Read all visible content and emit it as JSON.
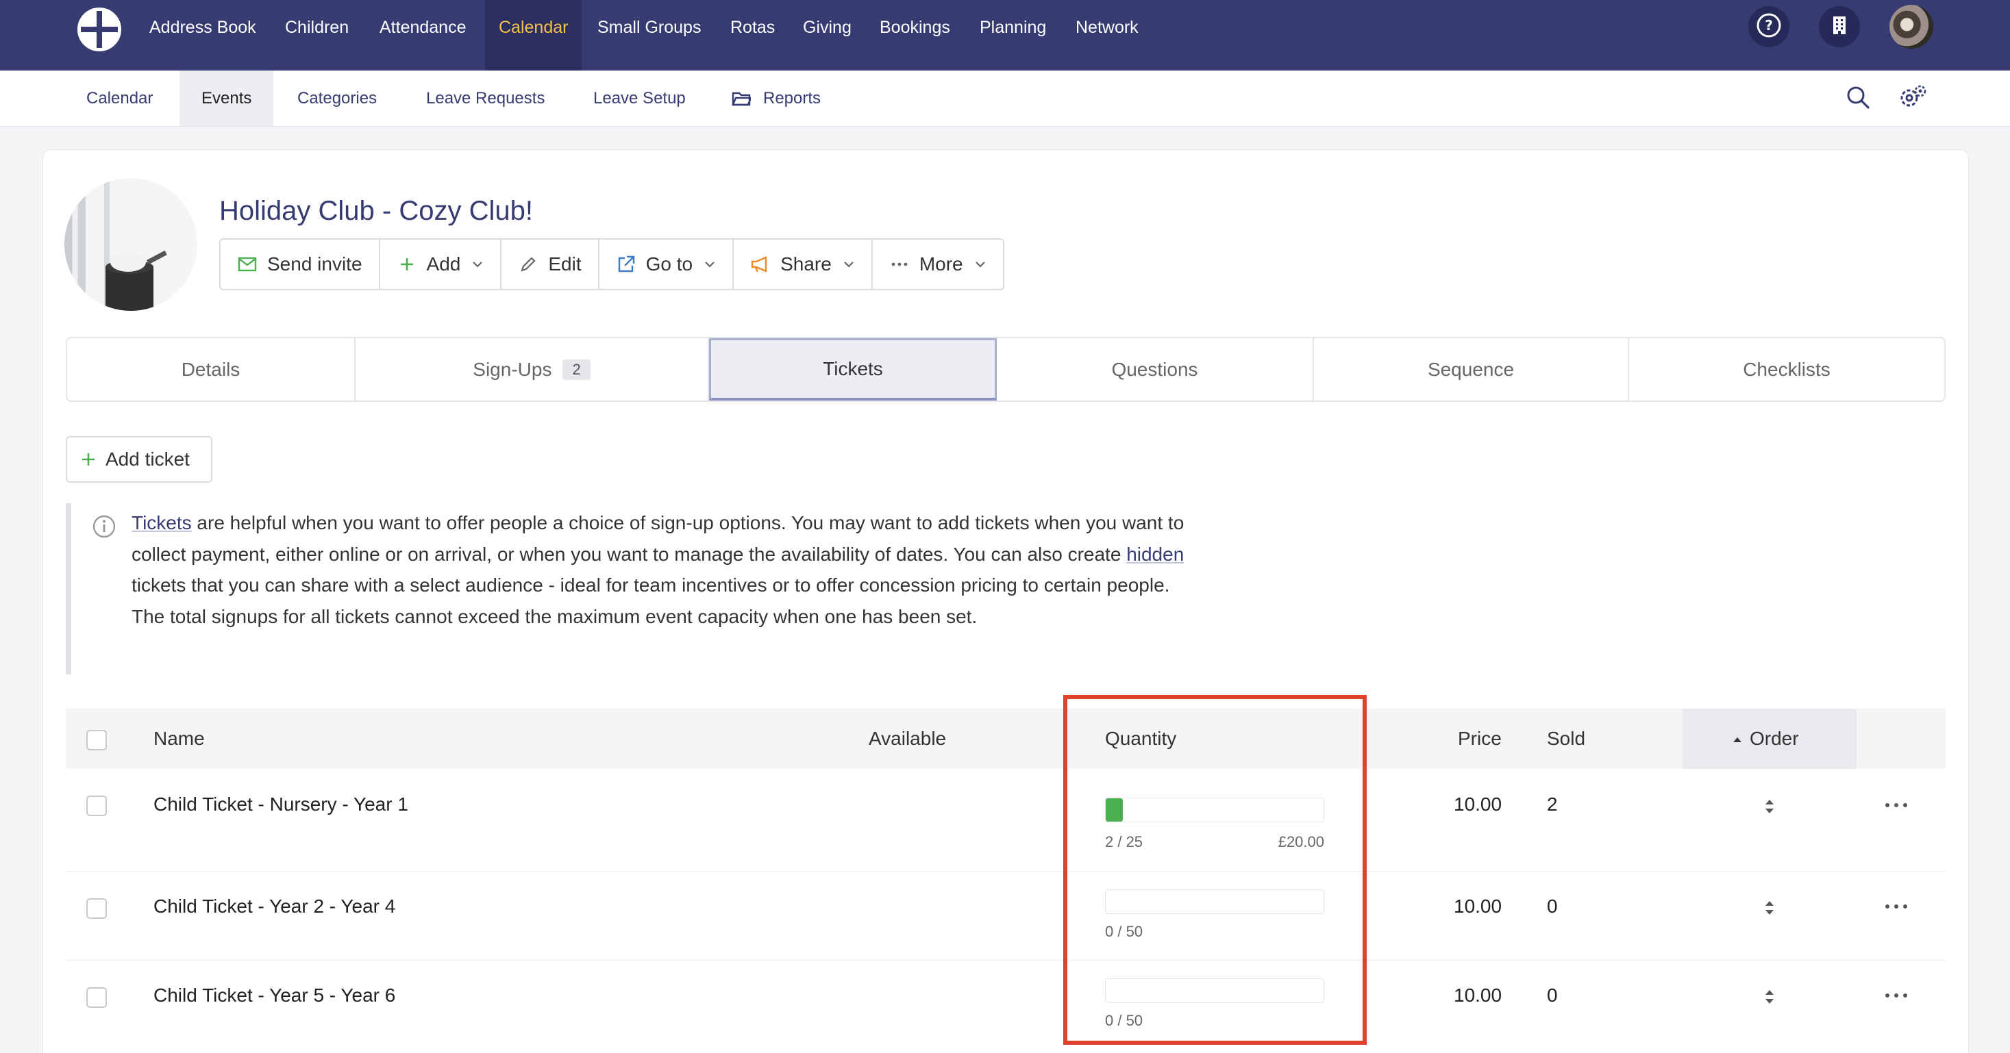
{
  "topnav": {
    "items": [
      "Address Book",
      "Children",
      "Attendance",
      "Calendar",
      "Small Groups",
      "Rotas",
      "Giving",
      "Bookings",
      "Planning",
      "Network"
    ],
    "active": "Calendar",
    "accent": "#f5c04f",
    "background": "#363b72"
  },
  "subnav": {
    "items": [
      "Calendar",
      "Events",
      "Categories",
      "Leave Requests",
      "Leave Setup",
      "Reports"
    ],
    "active": "Events"
  },
  "event": {
    "title": "Holiday Club - Cozy Club!",
    "actions": {
      "send_invite": "Send invite",
      "add": "Add",
      "edit": "Edit",
      "go_to": "Go to",
      "share": "Share",
      "more": "More"
    }
  },
  "tabs": {
    "details": "Details",
    "signups": "Sign-Ups",
    "signups_count": "2",
    "tickets": "Tickets",
    "questions": "Questions",
    "sequence": "Sequence",
    "checklists": "Checklists",
    "active": "Tickets"
  },
  "tickets": {
    "add_ticket": "Add ticket",
    "info": {
      "link_tickets": "Tickets",
      "part1": " are helpful when you want to offer people a choice of sign-up options. You may want to add tickets when you want to collect payment, either online or on arrival, or when you want to manage the availability of dates. You can also create ",
      "link_hidden": "hidden",
      "part2": " tickets that you can share with a select audience - ideal for team incentives or to offer concession pricing to certain people. The total signups for all tickets cannot exceed the maximum event capacity when one has been set."
    },
    "headers": {
      "name": "Name",
      "available": "Available",
      "quantity": "Quantity",
      "price": "Price",
      "sold": "Sold",
      "order": "Order"
    },
    "rows": [
      {
        "name": "Child Ticket - Nursery - Year 1",
        "quantity_label": "2 / 25",
        "fill_fraction": 0.08,
        "total": "£20.00",
        "price": "10.00",
        "sold": "2"
      },
      {
        "name": "Child Ticket - Year 2 - Year 4",
        "quantity_label": "0 / 50",
        "fill_fraction": 0,
        "total": "",
        "price": "10.00",
        "sold": "0"
      },
      {
        "name": "Child Ticket - Year 5 - Year 6",
        "quantity_label": "0 / 50",
        "fill_fraction": 0,
        "total": "",
        "price": "10.00",
        "sold": "0"
      }
    ],
    "highlight_color": "#e0412b"
  }
}
